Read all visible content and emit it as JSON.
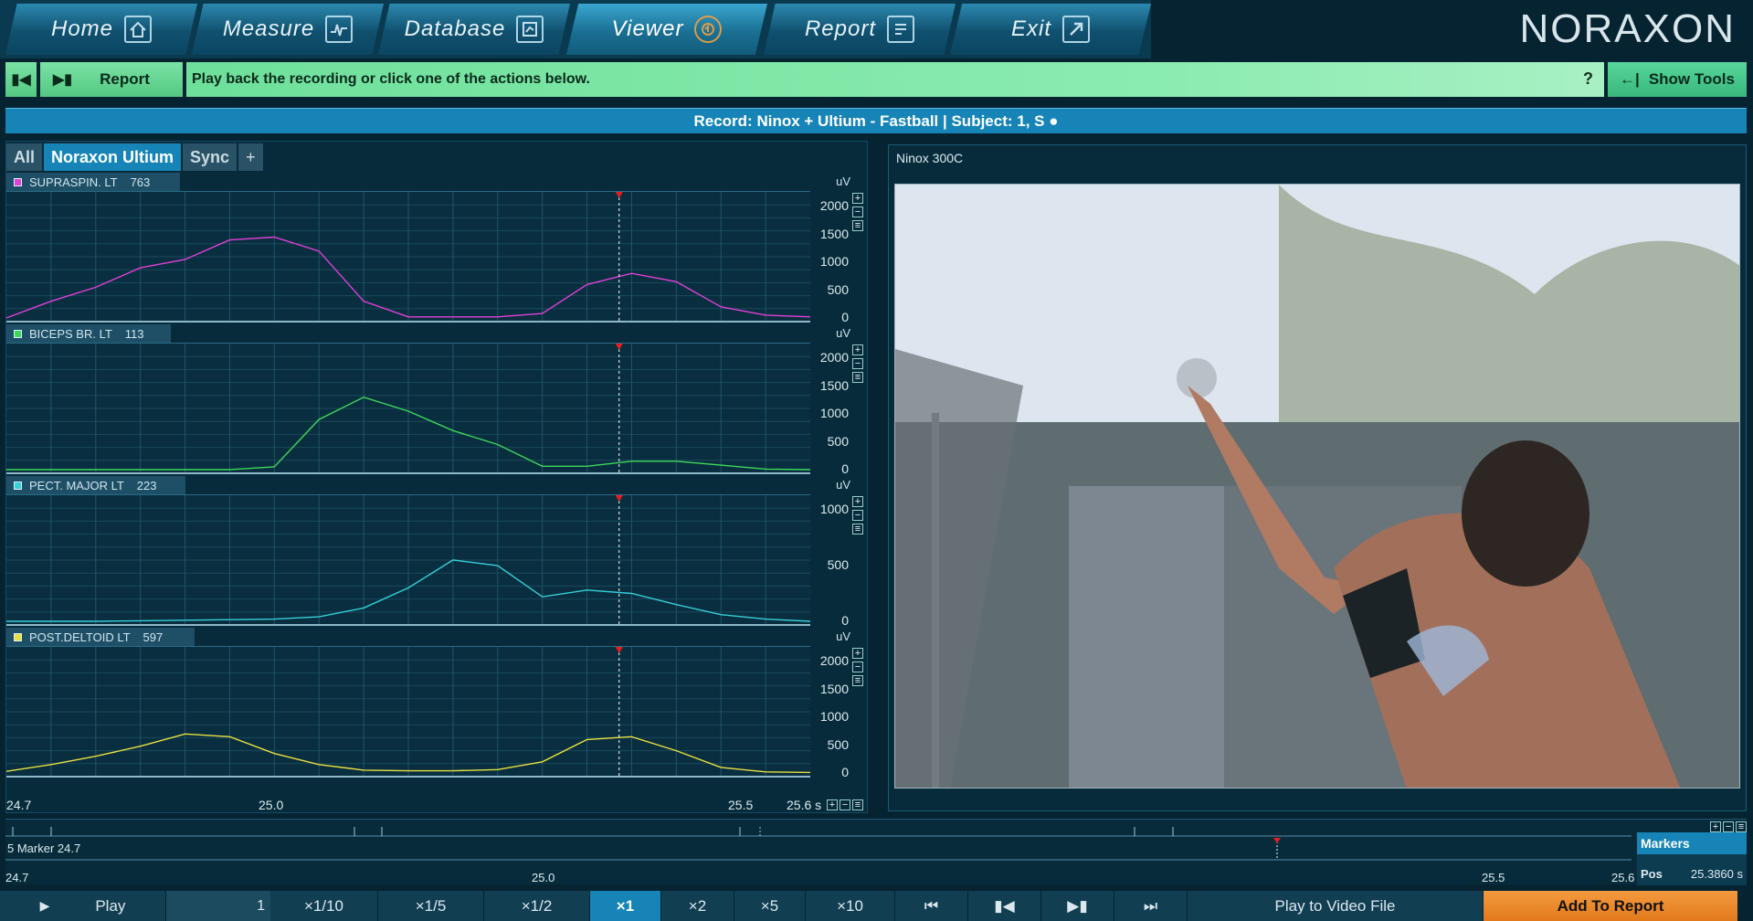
{
  "nav": {
    "tabs": [
      {
        "label": "Home",
        "icon": "home-icon"
      },
      {
        "label": "Measure",
        "icon": "measure-icon"
      },
      {
        "label": "Database",
        "icon": "database-icon"
      },
      {
        "label": "Viewer",
        "icon": "viewer-icon"
      },
      {
        "label": "Report",
        "icon": "report-icon"
      },
      {
        "label": "Exit",
        "icon": "exit-icon"
      }
    ],
    "active": "Viewer",
    "brand": "NORAXON"
  },
  "actionbar": {
    "report_label": "Report",
    "hint": "Play back the recording or click one of the actions below.",
    "help": "?",
    "show_tools_label": "Show Tools"
  },
  "record": {
    "title": "Record: Ninox + Ultium - Fastball | Subject: 1, S ●"
  },
  "channel_tabs": [
    "All",
    "Noraxon Ultium",
    "Sync",
    "+"
  ],
  "channels": [
    {
      "name": "SUPRASPIN. LT",
      "value": "763",
      "color": "#e040d8",
      "unit": "uV",
      "ticks": [
        "2000",
        "1500",
        "1000",
        "500",
        "0"
      ],
      "ymax": 2000
    },
    {
      "name": "BICEPS BR. LT",
      "value": "113",
      "color": "#3ed85a",
      "unit": "uV",
      "ticks": [
        "2000",
        "1500",
        "1000",
        "500",
        "0"
      ],
      "ymax": 2000
    },
    {
      "name": "PECT. MAJOR LT",
      "value": "223",
      "color": "#36d0d8",
      "unit": "uV",
      "ticks": [
        "1000",
        "500",
        "0"
      ],
      "ymax": 1000
    },
    {
      "name": "POST.DELTOID LT",
      "value": "597",
      "color": "#e8e040",
      "unit": "uV",
      "ticks": [
        "2000",
        "1500",
        "1000",
        "500",
        "0"
      ],
      "ymax": 2000
    }
  ],
  "chart_data": {
    "type": "line",
    "x": [
      24.7,
      24.75,
      24.8,
      24.85,
      24.9,
      24.95,
      25.0,
      25.05,
      25.1,
      25.15,
      25.2,
      25.25,
      25.3,
      25.35,
      25.4,
      25.45,
      25.5,
      25.55,
      25.6
    ],
    "xlim": [
      24.7,
      25.6
    ],
    "cursor_x": 25.386,
    "series": [
      {
        "name": "SUPRASPIN. LT",
        "values": [
          0,
          300,
          550,
          900,
          1050,
          1400,
          1450,
          1200,
          300,
          20,
          20,
          20,
          80,
          600,
          800,
          650,
          200,
          50,
          20
        ]
      },
      {
        "name": "BICEPS BR. LT",
        "values": [
          0,
          0,
          0,
          0,
          0,
          0,
          50,
          900,
          1300,
          1050,
          700,
          450,
          60,
          60,
          150,
          150,
          80,
          10,
          0
        ]
      },
      {
        "name": "PECT. MAJOR LT",
        "values": [
          0,
          0,
          0,
          5,
          10,
          15,
          20,
          40,
          120,
          300,
          550,
          500,
          220,
          280,
          250,
          150,
          60,
          20,
          0
        ]
      },
      {
        "name": "POST.DELTOID LT",
        "values": [
          30,
          150,
          300,
          480,
          700,
          650,
          350,
          150,
          50,
          40,
          40,
          60,
          200,
          600,
          650,
          400,
          100,
          20,
          10
        ]
      }
    ],
    "x_ticks": [
      "24.7",
      "25.0",
      "25.5",
      "25.6 s"
    ]
  },
  "video": {
    "title": "Ninox 300C"
  },
  "markers": {
    "row_label": "5 Marker 24.7",
    "axis_ticks": [
      "24.7",
      "25.0",
      "25.5",
      "25.6"
    ],
    "header": "Markers",
    "pos_label": "Pos",
    "pos_value": "25.3860 s"
  },
  "transport": {
    "play": "Play",
    "speed_value": "1",
    "speeds": [
      "×1/10",
      "×1/5",
      "×1/2",
      "×1",
      "×2",
      "×5",
      "×10"
    ],
    "active_speed": "×1",
    "play_to_video": "Play to Video File",
    "add_to_report": "Add To Report"
  }
}
